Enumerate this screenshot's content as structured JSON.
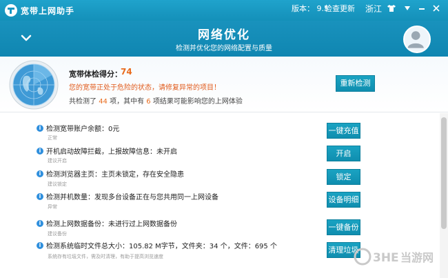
{
  "titlebar": {
    "app_title": "宽带上网助手",
    "version": "版本： 9.5",
    "update_link": "检查更新",
    "city": "浙江"
  },
  "banner": {
    "title": "网络优化",
    "subtitle": "检测并优化您的网络配置与质量"
  },
  "summary": {
    "score_label": "宽带体检得分：",
    "score_value": "74",
    "warning": "您的宽带正处于危险的状态，请修复异常的项目！",
    "count_prefix": "共检测了",
    "count_total": "44",
    "count_mid": "项，其中有",
    "count_issues": "6",
    "count_suffix": "项结果可能影响您的上网体验",
    "recheck_label": "重新检测"
  },
  "items": [
    {
      "title": "检测宽带账户余额：0元",
      "note": "正常",
      "button": "一键充值"
    },
    {
      "title": "开机启动故障拦截，上报故障信息：未开启",
      "note": "建议开启",
      "button": "开启"
    },
    {
      "title": "检测浏览器主页：主页未锁定，存在安全隐患",
      "note": "建议锁定",
      "button": "锁定"
    },
    {
      "title": "检测并机数量：发现多台设备正在与您共用同一上网设备",
      "note": "异常",
      "button": "设备明细"
    },
    {
      "title": "检测上网数据备份：未进行过上网数据备份",
      "note": "建议备份",
      "button": "一键备份"
    },
    {
      "title": "检测系统临时文件总大小：105.82 M字节，文件夹：34 个，文件：695 个",
      "note": "系统存有垃圾文件，需及时清理，有助于提高浏览速度",
      "button": "清理垃圾"
    }
  ],
  "watermark": {
    "brand": "3HE",
    "site": "当游网"
  },
  "colors": {
    "primary": "#1596c2",
    "button": "#1aa3c2",
    "accent": "#e96b1d",
    "warning": "#e05a1b",
    "info_icon": "#2f8fdd"
  },
  "icons": {
    "logo": "app-logo-icon",
    "skin": "tshirt-icon",
    "menu": "chevron-down-icon",
    "minimize": "minimize-icon",
    "close": "close-icon",
    "collapse": "chevron-down-icon",
    "avatar": "user-avatar-icon",
    "radar": "radar-globe-icon",
    "item": "info-icon"
  }
}
